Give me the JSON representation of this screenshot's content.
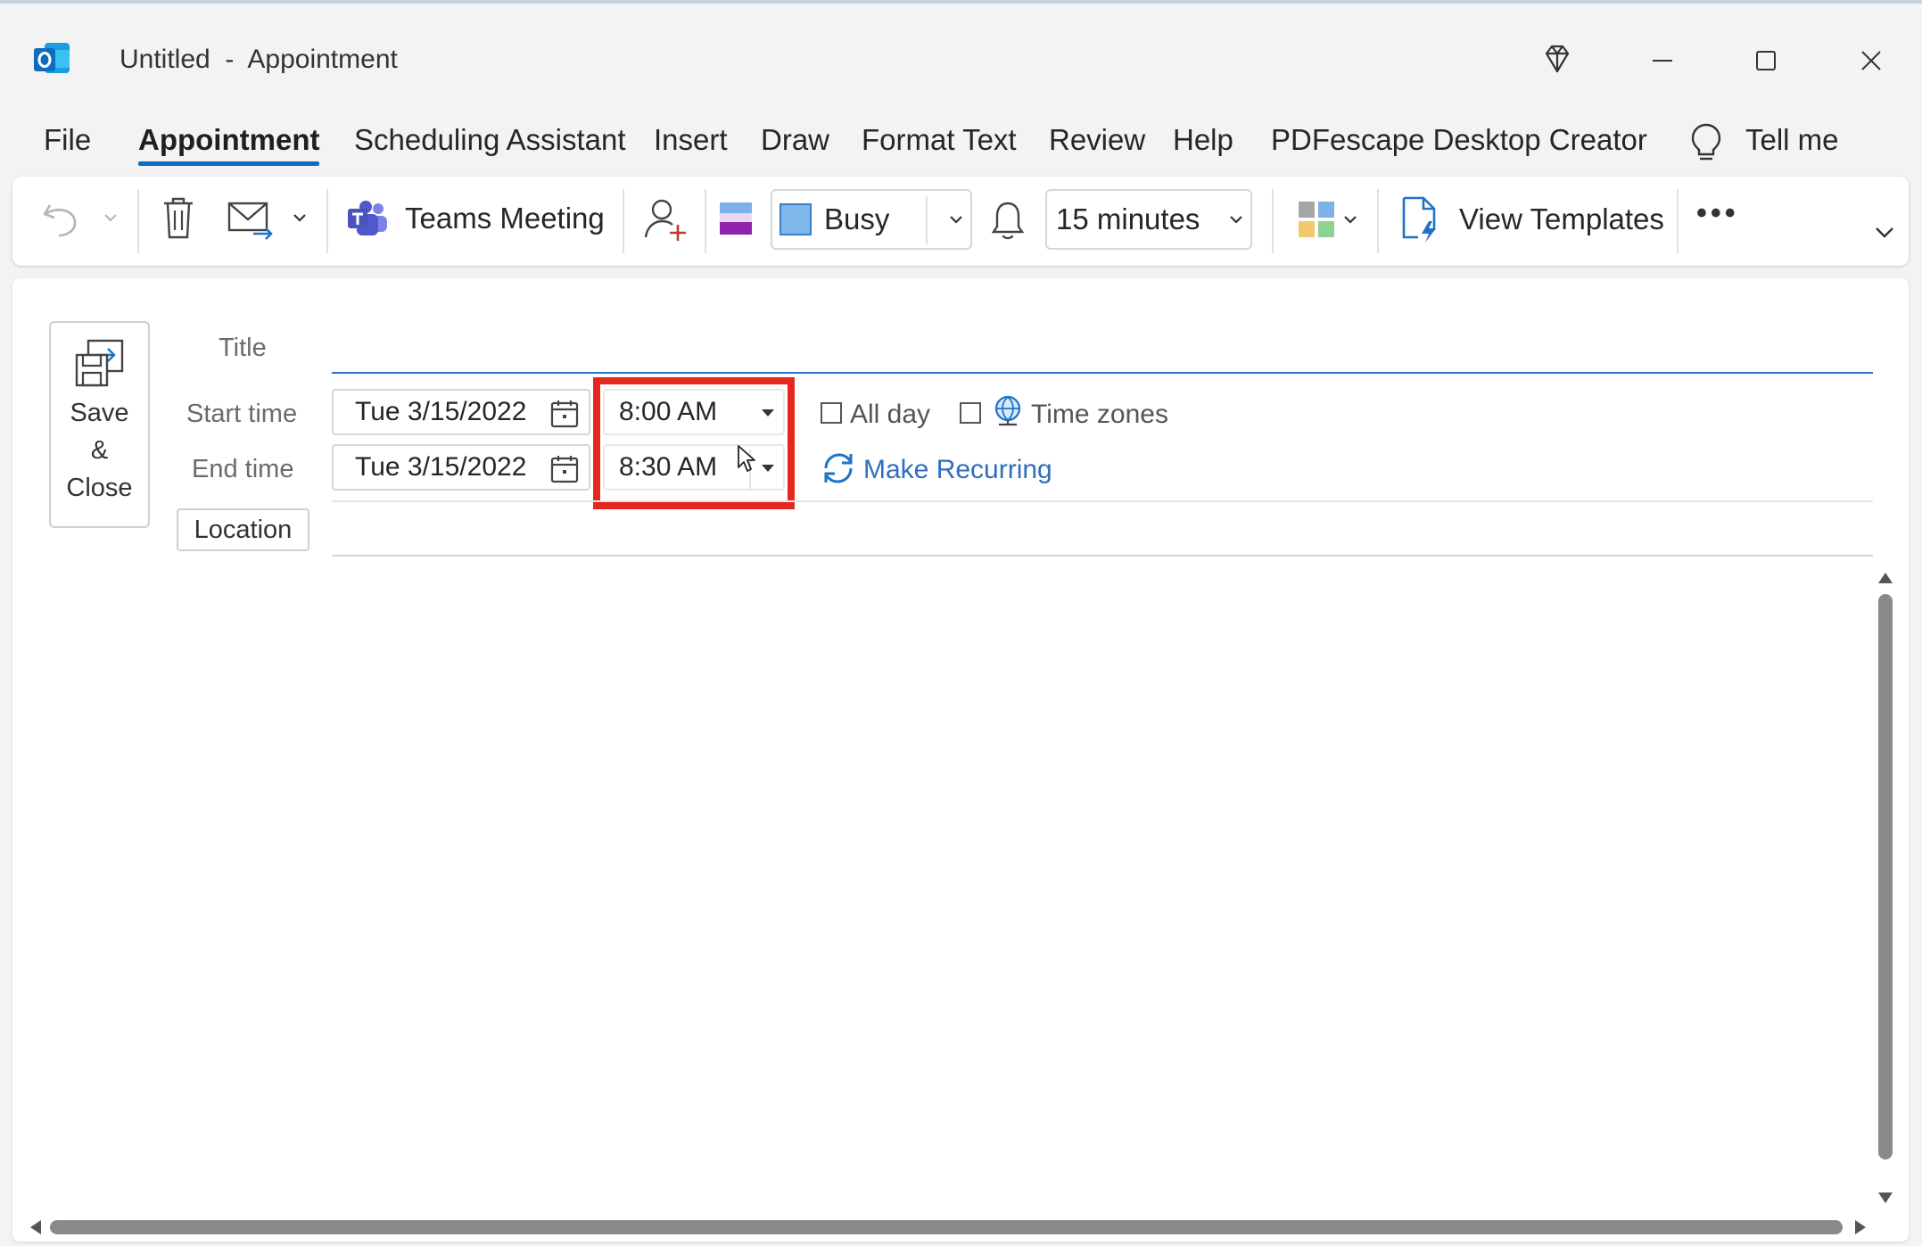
{
  "window": {
    "title": "Untitled  -  Appointment",
    "controls": [
      "minimize-icon",
      "maximize-icon",
      "close-icon"
    ]
  },
  "menu": {
    "tabs": [
      "File",
      "Appointment",
      "Scheduling Assistant",
      "Insert",
      "Draw",
      "Format Text",
      "Review",
      "Help",
      "PDFescape Desktop Creator"
    ],
    "active_tab": "Appointment",
    "tell_me": "Tell me"
  },
  "ribbon": {
    "teams_meeting": "Teams Meeting",
    "show_as": "Busy",
    "reminder": "15 minutes",
    "view_templates": "View Templates",
    "more": "•••"
  },
  "form": {
    "save_close": {
      "line1": "Save",
      "line2": "&",
      "line3": "Close"
    },
    "title_label": "Title",
    "title_value": "",
    "start_label": "Start time",
    "end_label": "End time",
    "start_date": "Tue 3/15/2022",
    "end_date": "Tue 3/15/2022",
    "start_time": "8:00 AM",
    "end_time": "8:30 AM",
    "all_day": "All day",
    "all_day_checked": false,
    "time_zones": "Time zones",
    "time_zones_checked": false,
    "make_recurring": "Make Recurring",
    "location_button": "Location",
    "location_value": ""
  },
  "colors": {
    "accent": "#0f6cbd",
    "highlight": "#e4281f",
    "link": "#2f6fbd"
  }
}
